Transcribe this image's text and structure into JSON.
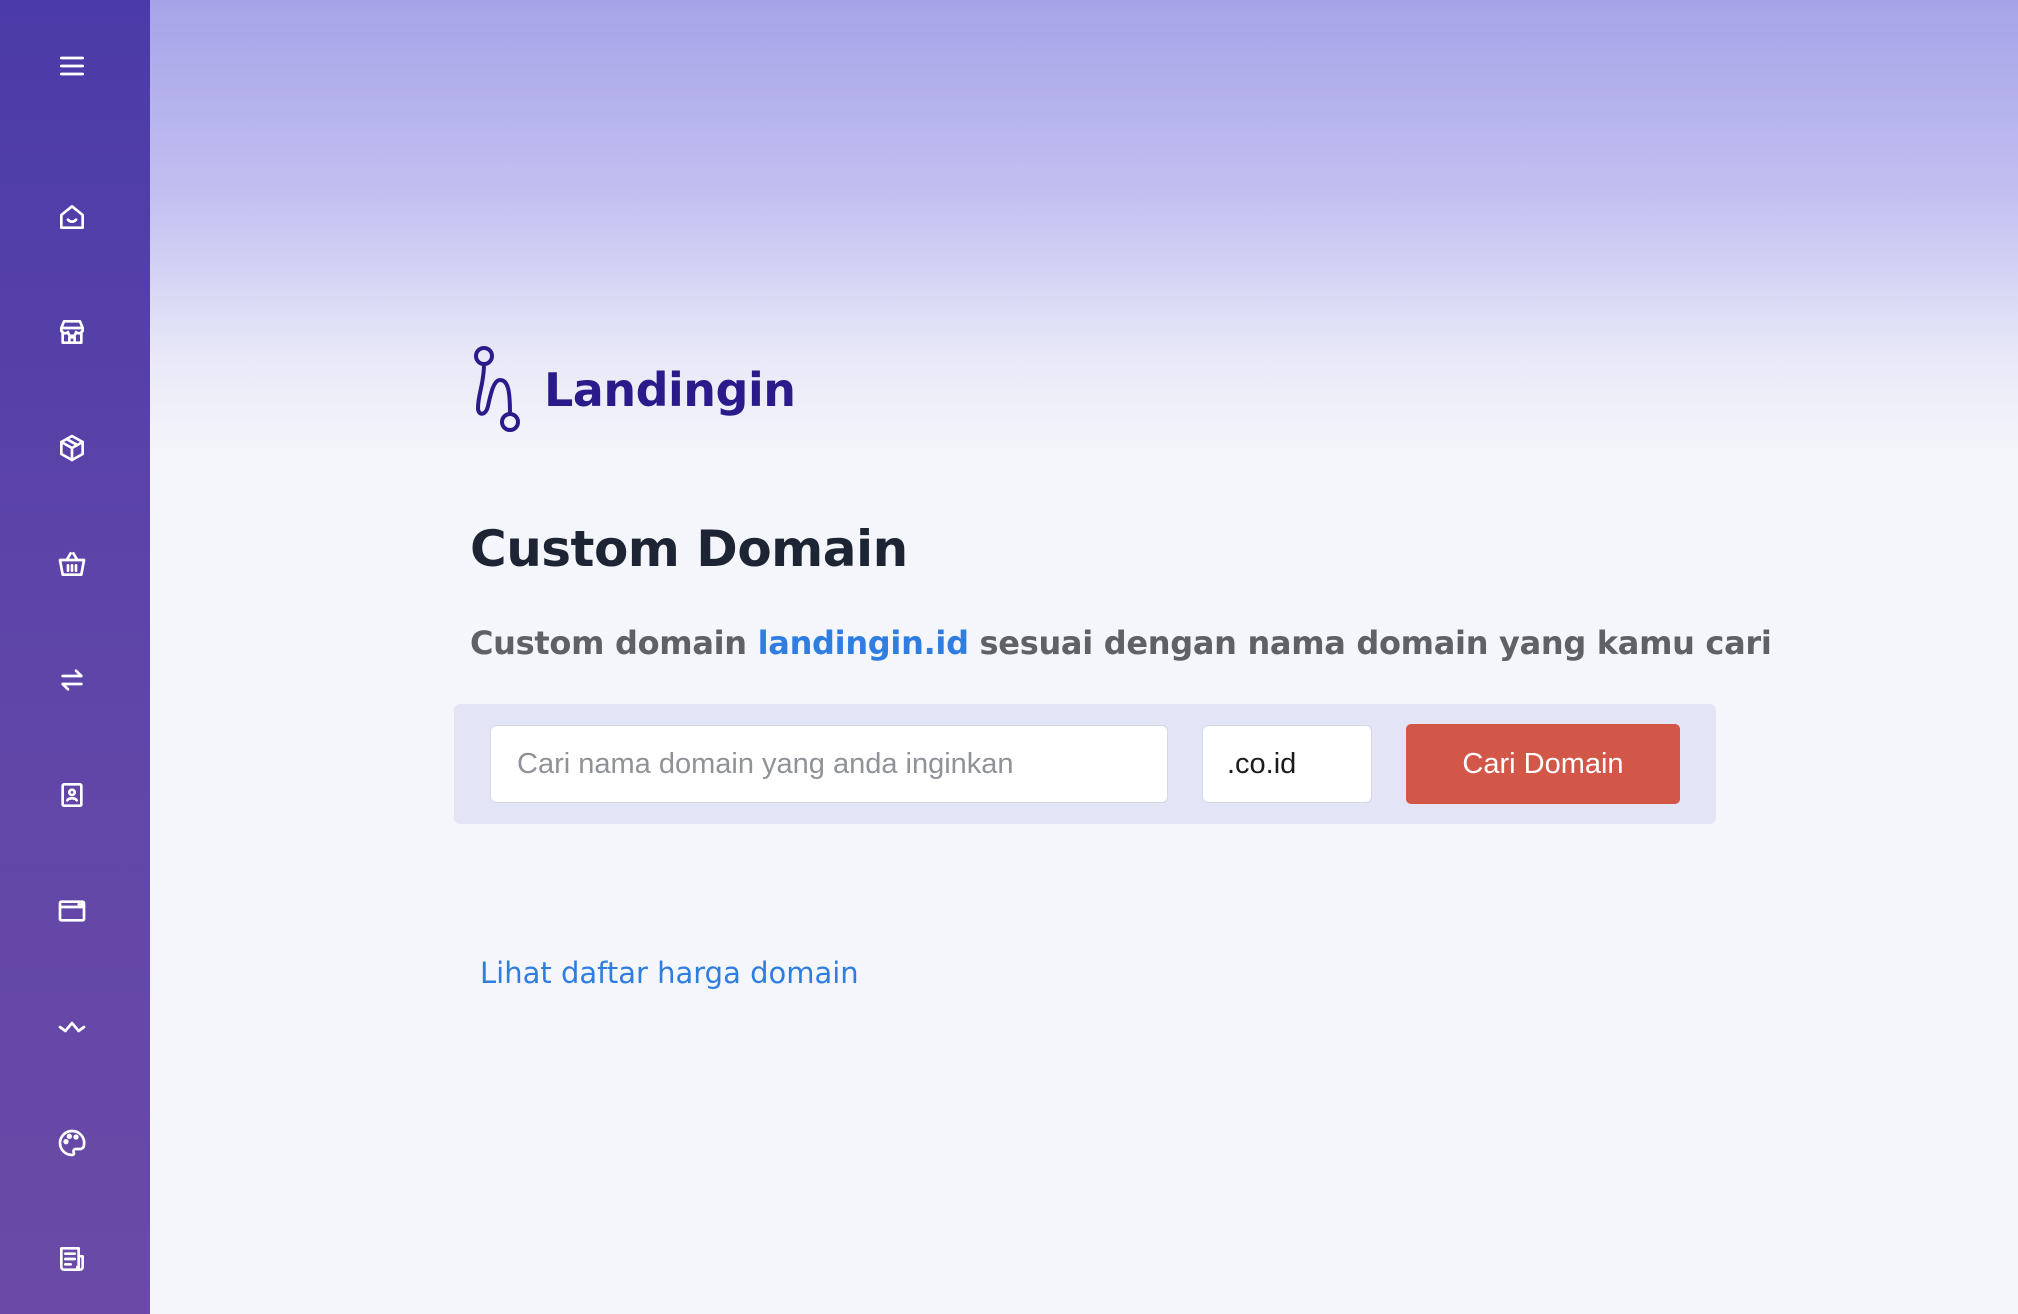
{
  "sidebar": {
    "items": [
      {
        "icon": "menu-icon"
      },
      {
        "icon": "home-icon"
      },
      {
        "icon": "store-icon"
      },
      {
        "icon": "box-icon"
      },
      {
        "icon": "basket-icon"
      },
      {
        "icon": "transfer-icon"
      },
      {
        "icon": "contact-icon"
      },
      {
        "icon": "browser-icon"
      },
      {
        "icon": "analytics-icon"
      },
      {
        "icon": "palette-icon"
      },
      {
        "icon": "article-icon"
      }
    ],
    "color": "#4b3ba8"
  },
  "brand": {
    "name": "Landingin",
    "color": "#2a1b8a"
  },
  "page": {
    "title": "Custom Domain",
    "subtitle_prefix": "Custom domain",
    "subtitle_highlight": "landingin.id",
    "subtitle_suffix": "sesuai dengan nama domain yang kamu cari"
  },
  "search": {
    "placeholder": "Cari nama domain yang anda inginkan",
    "value": "",
    "tld": ".co.id",
    "button_label": "Cari Domain",
    "button_color": "#d25749"
  },
  "links": {
    "price_list": "Lihat daftar harga domain",
    "link_color": "#2f7de1"
  }
}
